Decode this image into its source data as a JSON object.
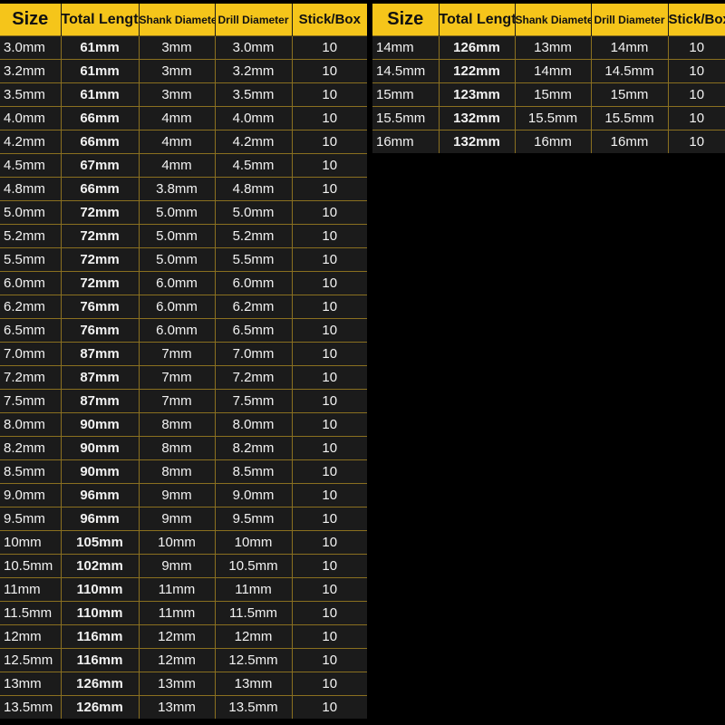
{
  "headers": [
    "Size",
    "Total Length",
    "Shank Diameter",
    "Drill Diameter",
    "Stick/Box"
  ],
  "left_table": {
    "rows": [
      [
        "3.0mm",
        "61mm",
        "3mm",
        "3.0mm",
        "10"
      ],
      [
        "3.2mm",
        "61mm",
        "3mm",
        "3.2mm",
        "10"
      ],
      [
        "3.5mm",
        "61mm",
        "3mm",
        "3.5mm",
        "10"
      ],
      [
        "4.0mm",
        "66mm",
        "4mm",
        "4.0mm",
        "10"
      ],
      [
        "4.2mm",
        "66mm",
        "4mm",
        "4.2mm",
        "10"
      ],
      [
        "4.5mm",
        "67mm",
        "4mm",
        "4.5mm",
        "10"
      ],
      [
        "4.8mm",
        "66mm",
        "3.8mm",
        "4.8mm",
        "10"
      ],
      [
        "5.0mm",
        "72mm",
        "5.0mm",
        "5.0mm",
        "10"
      ],
      [
        "5.2mm",
        "72mm",
        "5.0mm",
        "5.2mm",
        "10"
      ],
      [
        "5.5mm",
        "72mm",
        "5.0mm",
        "5.5mm",
        "10"
      ],
      [
        "6.0mm",
        "72mm",
        "6.0mm",
        "6.0mm",
        "10"
      ],
      [
        "6.2mm",
        "76mm",
        "6.0mm",
        "6.2mm",
        "10"
      ],
      [
        "6.5mm",
        "76mm",
        "6.0mm",
        "6.5mm",
        "10"
      ],
      [
        "7.0mm",
        "87mm",
        "7mm",
        "7.0mm",
        "10"
      ],
      [
        "7.2mm",
        "87mm",
        "7mm",
        "7.2mm",
        "10"
      ],
      [
        "7.5mm",
        "87mm",
        "7mm",
        "7.5mm",
        "10"
      ],
      [
        "8.0mm",
        "90mm",
        "8mm",
        "8.0mm",
        "10"
      ],
      [
        "8.2mm",
        "90mm",
        "8mm",
        "8.2mm",
        "10"
      ],
      [
        "8.5mm",
        "90mm",
        "8mm",
        "8.5mm",
        "10"
      ],
      [
        "9.0mm",
        "96mm",
        "9mm",
        "9.0mm",
        "10"
      ],
      [
        "9.5mm",
        "96mm",
        "9mm",
        "9.5mm",
        "10"
      ],
      [
        "10mm",
        "105mm",
        "10mm",
        "10mm",
        "10"
      ],
      [
        "10.5mm",
        "102mm",
        "9mm",
        "10.5mm",
        "10"
      ],
      [
        "11mm",
        "110mm",
        "11mm",
        "11mm",
        "10"
      ],
      [
        "11.5mm",
        "110mm",
        "11mm",
        "11.5mm",
        "10"
      ],
      [
        "12mm",
        "116mm",
        "12mm",
        "12mm",
        "10"
      ],
      [
        "12.5mm",
        "116mm",
        "12mm",
        "12.5mm",
        "10"
      ],
      [
        "13mm",
        "126mm",
        "13mm",
        "13mm",
        "10"
      ],
      [
        "13.5mm",
        "126mm",
        "13mm",
        "13.5mm",
        "10"
      ]
    ]
  },
  "right_table": {
    "rows": [
      [
        "14mm",
        "126mm",
        "13mm",
        "14mm",
        "10"
      ],
      [
        "14.5mm",
        "122mm",
        "14mm",
        "14.5mm",
        "10"
      ],
      [
        "15mm",
        "123mm",
        "15mm",
        "15mm",
        "10"
      ],
      [
        "15.5mm",
        "132mm",
        "15.5mm",
        "15.5mm",
        "10"
      ],
      [
        "16mm",
        "132mm",
        "16mm",
        "16mm",
        "10"
      ]
    ]
  },
  "colors": {
    "header_bg": "#f5c51a",
    "body_bg": "#1b1b1b",
    "grid_line": "#8a7020",
    "text": "#f2f2f2"
  }
}
